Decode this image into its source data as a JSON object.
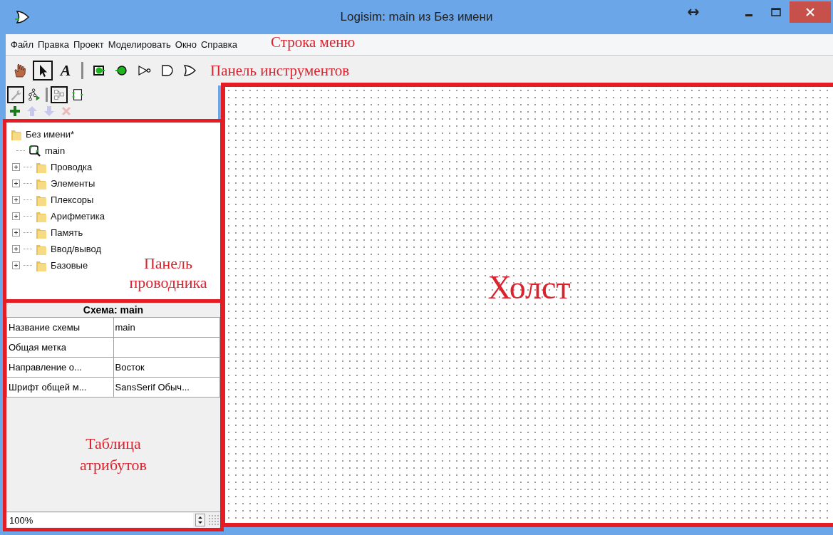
{
  "window": {
    "title": "Logisim: main из Без имени"
  },
  "menu": [
    "Файл",
    "Правка",
    "Проект",
    "Моделировать",
    "Окно",
    "Справка"
  ],
  "toolbar": [
    {
      "kind": "hand",
      "selected": false
    },
    {
      "kind": "arrow",
      "selected": true
    },
    {
      "kind": "text",
      "label": "A",
      "selected": false
    },
    {
      "kind": "separator"
    },
    {
      "kind": "input-pin",
      "selected": false
    },
    {
      "kind": "output-pin",
      "selected": false
    },
    {
      "kind": "not-gate",
      "selected": false
    },
    {
      "kind": "and-gate",
      "selected": false
    },
    {
      "kind": "or-gate",
      "selected": false
    }
  ],
  "explorer_toolbar": [
    {
      "kind": "wrench",
      "selected": true
    },
    {
      "kind": "sim-tree",
      "selected": false
    },
    {
      "kind": "separator"
    },
    {
      "kind": "layout",
      "selected": true
    },
    {
      "kind": "appearance",
      "selected": false
    }
  ],
  "project_toolbar": [
    {
      "kind": "add",
      "disabled": false
    },
    {
      "kind": "up",
      "disabled": true
    },
    {
      "kind": "down",
      "disabled": true
    },
    {
      "kind": "delete",
      "disabled": true
    }
  ],
  "explorer": {
    "label": "Без имени*",
    "children": [
      {
        "kind": "circuit",
        "label": "main"
      },
      {
        "kind": "library",
        "label": "Проводка",
        "expanded": false
      },
      {
        "kind": "library",
        "label": "Элементы",
        "expanded": false
      },
      {
        "kind": "library",
        "label": "Плексоры",
        "expanded": false
      },
      {
        "kind": "library",
        "label": "Арифметика",
        "expanded": false
      },
      {
        "kind": "library",
        "label": "Память",
        "expanded": false
      },
      {
        "kind": "library",
        "label": "Ввод/вывод",
        "expanded": false
      },
      {
        "kind": "library",
        "label": "Базовые",
        "expanded": false
      }
    ]
  },
  "attributes": {
    "title": "Схема: main",
    "rows": [
      {
        "name": "Название схемы",
        "value": "main"
      },
      {
        "name": "Общая метка"
      },
      {
        "name": "Направление о...",
        "value": "Восток"
      },
      {
        "name": "Шрифт общей м...",
        "value": "SansSerif Обыч..."
      }
    ]
  },
  "zoom": "100%",
  "annotations": {
    "menu": "Строка меню",
    "toolbar": "Панель инструментов",
    "explorer": "Панель проводника",
    "attributes": "Таблица атрибутов",
    "canvas": "Холст"
  }
}
